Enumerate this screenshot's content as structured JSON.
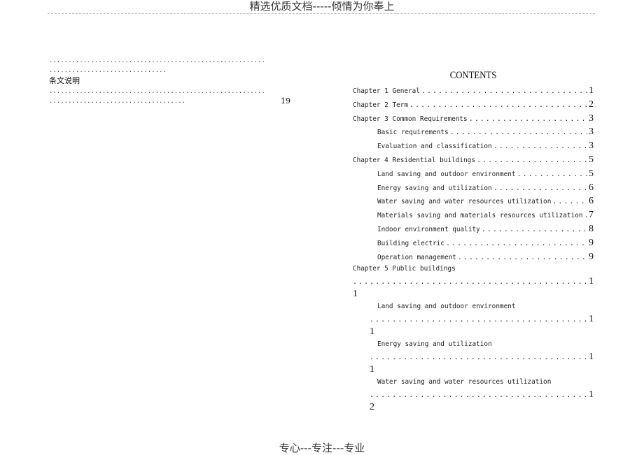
{
  "header": {
    "text": "精选优质文档-----倾情为你奉上"
  },
  "footer": {
    "text": "专心---专注---专业"
  },
  "left_block": {
    "label": "条文说明",
    "page": "19"
  },
  "toc": {
    "title": "CONTENTS",
    "entries": [
      {
        "label": "Chapter 1  General",
        "page": "1",
        "level": 0
      },
      {
        "label": "Chapter 2  Term",
        "page": "2",
        "level": 0
      },
      {
        "label": "Chapter 3  Common Requirements",
        "page": "3",
        "level": 0
      },
      {
        "label": "Basic requirements",
        "page": "3",
        "level": 1
      },
      {
        "label": "Evaluation and classification",
        "page": "3",
        "level": 1
      },
      {
        "label": "Chapter 4  Residential buildings",
        "page": "5",
        "level": 0
      },
      {
        "label": "Land saving and outdoor environment",
        "page": "5",
        "level": 1
      },
      {
        "label": "Energy saving and utilization",
        "page": "6",
        "level": 1
      },
      {
        "label": "Water saving and water resources utilization",
        "page": "6",
        "level": 1
      },
      {
        "label": "Materials saving and materials resources utilization",
        "page": "7",
        "level": 1
      },
      {
        "label": "Indoor environment quality",
        "page": "8",
        "level": 1
      },
      {
        "label": "Building electric",
        "page": "9",
        "level": 1
      },
      {
        "label": "Operation management",
        "page": "9",
        "level": 1
      }
    ],
    "wrapped_entries": [
      {
        "label": "Chapter 5  Public buildings",
        "page_line1": "1",
        "page_line2": "1",
        "level": 0
      },
      {
        "label": "Land saving and outdoor environment",
        "page_line1": "1",
        "page_line2": "1",
        "level": 1
      },
      {
        "label": "Energy saving and utilization",
        "page_line1": "1",
        "page_line2": "1",
        "level": 1
      },
      {
        "label": "Water saving and water resources utilization",
        "page_line1": "1",
        "page_line2": "2",
        "level": 1
      }
    ]
  }
}
